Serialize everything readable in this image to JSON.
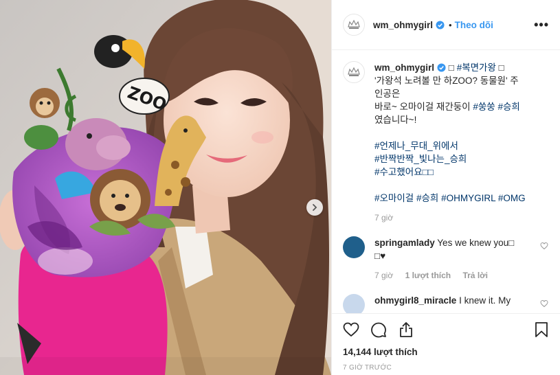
{
  "post": {
    "username": "wm_ohmygirl",
    "follow_label": "Theo dõi",
    "more_label": "•••",
    "caption": {
      "username": "wm_ohmygirl",
      "line1_prefix": "□ ",
      "line1_tag": "#복면가왕",
      "line1_suffix": " □",
      "line2": "'가왕석 노려볼 만 하ZOO? 동물원' 주",
      "line3": "인공은",
      "line4_prefix": "바로~ 오마이걸 재간둥이 ",
      "line4_tag1": "#쑹쑹",
      "line4_tag2": "#승희",
      "line5": "였습니다~!",
      "tags_block1": [
        "#언제나_무대_위에서",
        "#반짝반짝_빛나는_승희",
        "#수고했어요□□"
      ],
      "tags_block2": [
        "#오마이걸",
        "#승희",
        "#OHMYGIRL",
        "#OMG"
      ],
      "time": "7 giờ"
    },
    "comments": [
      {
        "username": "springamlady",
        "text": "Yes we knew you□",
        "text2": "□♥",
        "time": "7 giờ",
        "likes": "1 lượt thích",
        "reply": "Trả lời",
        "avatar_color": "#1f5f8b"
      },
      {
        "username": "ohmygirl8_miracle",
        "text": "I knew it. My",
        "avatar_color": "#c8d8ec"
      }
    ],
    "likes_count": "14,144 lượt thích",
    "timestamp": "7 GIỜ TRƯỚC"
  },
  "photo": {
    "mask_text": "ZOO"
  },
  "colors": {
    "link_blue": "#3897f0",
    "tag_blue": "#003569",
    "muted": "#999999",
    "verified_blue": "#3897f0"
  },
  "icons": [
    "heart-icon",
    "comment-icon",
    "share-icon",
    "bookmark-icon",
    "verified-icon",
    "chevron-right-icon"
  ]
}
